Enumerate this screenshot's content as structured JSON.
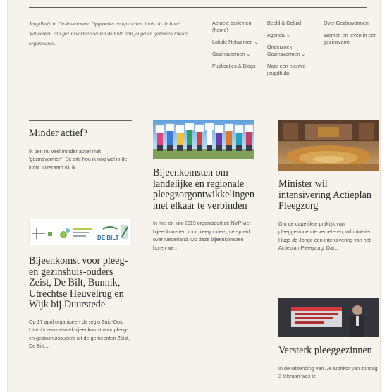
{
  "site": {
    "tagline": "Jeugdhulp in Gezinsvormen. Opgroeien en opvoeden 'thuis' in de buurt. Netwerken van gezinsvormen willen de hulp aan jeugd en gezinnen lokaal organiseren."
  },
  "menu": {
    "col1": [
      "Actuele berichten (home)",
      "Lokale Netwerken ⌄",
      "Gezinsvormen ⌄",
      "Publicaties & Blogs"
    ],
    "col2": [
      "Beeld & Geluid",
      "Agenda ⌄",
      "Onderzoek Gezinsvormen ⌄",
      "Naar een nieuwe jeugdhulp"
    ],
    "col3": [
      "Over Gezinsvormen",
      "Werken en leven in een gezinsvorm"
    ]
  },
  "posts": [
    {
      "title": "Minder actief?",
      "excerpt": "Ik ben nu veel minder actief met 'gezinsvormen'. De site hou ik nog wel in de lucht. Uiteraard wil ik…"
    },
    {
      "title": "Bijeenkomst voor pleeg- en gezinshuis-ouders Zeist, De Bilt, Bunnik, Utrechtse Heuvelrug en Wijk bij Duurstede",
      "excerpt": "Op 17 april organiseert de regio Zuid-Oost Utrecht een netwerkbijeenkomst voor pleeg- en gezinshuisouders uit de gemeenten Zeist, De Bilt,…",
      "image_logo_text": "DE BILT"
    },
    {
      "title": "Bijeenkomsten om landelijke en regionale pleegzorgontwikkelingen met elkaar te verbinden",
      "excerpt": "In mei en juni 2019 organiseert de NVP vier bijeenkomsten voor pleegouders, verspreid over Nederland. Op deze bijeenkomsten horen we…"
    },
    {
      "title": "Minister wil intensivering Actieplan Pleegzorg",
      "excerpt": "Om de dagelijkse praktijk van pleeggezinnen te verbeteren, wil minister Hugo de Jonge een intensivering van het Actieplan Pleegzorg. Dat…"
    },
    {
      "title": "Versterk pleeggezinnen",
      "excerpt": "In de uitzending van De Monitor van zondag 3 februari was te"
    }
  ],
  "colors": {
    "page_bg": "#f6f2ec",
    "rule": "#5f5f5f",
    "heading": "#2b2b2b",
    "text": "#555555"
  }
}
